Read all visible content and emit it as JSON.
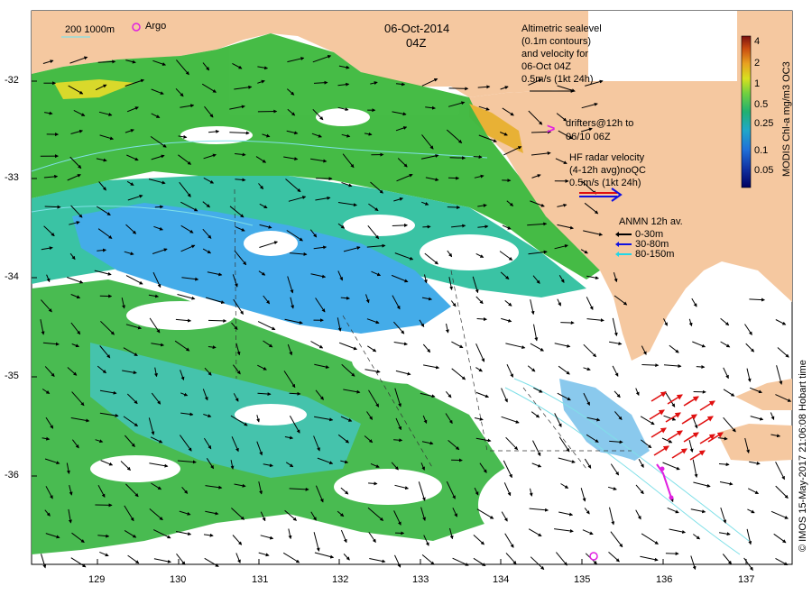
{
  "header": {
    "date": "06-Oct-2014",
    "time": "04Z",
    "scale_label": "200  1000m",
    "argo_label": "Argo"
  },
  "legend": {
    "altimetric": [
      "Altimetric sealevel",
      "(0.1m contours)",
      "and velocity for",
      "06-Oct 04Z",
      "0.5m/s (1kt 24h)"
    ],
    "drifters_symbol": ">",
    "drifters": [
      "drifters@12h to",
      "06/10 06Z"
    ],
    "hf_radar": [
      "HF radar velocity",
      "(4-12h avg)noQC",
      "0.5m/s (1kt 24h)"
    ],
    "anmn_title": "ANMN 12h av.",
    "anmn_items": [
      {
        "label": "0-30m",
        "color": "#000000"
      },
      {
        "label": "30-80m",
        "color": "#1010e0"
      },
      {
        "label": "80-150m",
        "color": "#20d8e8"
      }
    ]
  },
  "colorbar": {
    "title": "MODIS Chl-a mg/m3 OC3",
    "ticks": [
      "4",
      "2",
      "1",
      "0.5",
      "0.25",
      "0.1",
      "0.05"
    ],
    "colors": [
      "#7a1010",
      "#c84a10",
      "#e8a020",
      "#d8e020",
      "#70d040",
      "#20b070",
      "#20a8c8",
      "#2070d8",
      "#1030a0",
      "#000060"
    ]
  },
  "axes": {
    "x_ticks": [
      "129",
      "130",
      "131",
      "132",
      "133",
      "134",
      "135",
      "136",
      "137"
    ],
    "y_ticks": [
      "-32",
      "-33",
      "-34",
      "-35",
      "-36"
    ]
  },
  "credit": "© IMOS 15-May-2017 21:06:08 Hobart time",
  "colors": {
    "land": "#f5c8a0",
    "ocean": "#ffffff",
    "chl_green": "#3cb83c",
    "chl_teal": "#30c0a0",
    "chl_blue": "#3aa8e8",
    "hf_red": "#e01010",
    "drifter": "#e020e0"
  }
}
